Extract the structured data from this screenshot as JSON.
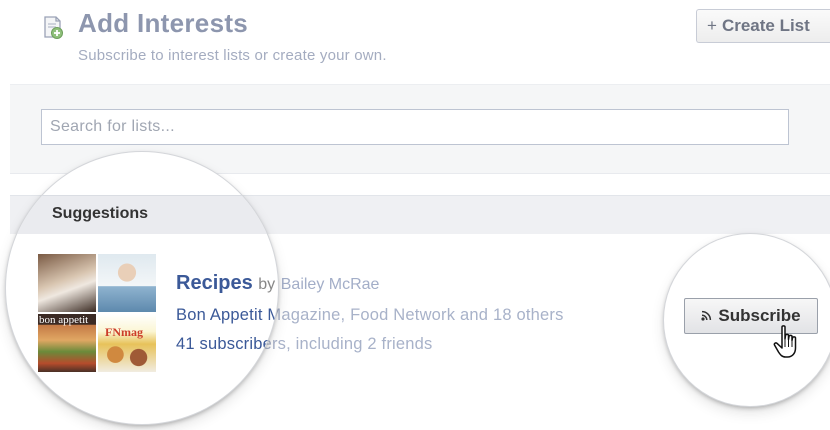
{
  "header": {
    "title": "Add Interests",
    "subtitle": "Subscribe to interest lists or create your own.",
    "create_list_label": "Create List",
    "create_list_icon": "plus-icon"
  },
  "search": {
    "placeholder": "Search for lists..."
  },
  "suggestions": {
    "heading": "Suggestions",
    "items": [
      {
        "name": "Recipes",
        "by_label": "by",
        "author": "Bailey McRae",
        "publishers": "Bon Appetit Magazine, Food Network",
        "and_label": "and",
        "others": "18 others",
        "subscribers": "41 subscribers, including 2 friends",
        "thumbnails": [
          {
            "icon": "chef-photo"
          },
          {
            "icon": "person-photo"
          },
          {
            "icon": "magazine-cover",
            "text": "bon appetit"
          },
          {
            "icon": "food-network-cover",
            "text": "FNmag"
          }
        ],
        "subscribe_label": "Subscribe",
        "subscribe_icon": "rss-icon"
      }
    ]
  },
  "cursor": {
    "icon": "hand-pointer-icon"
  }
}
